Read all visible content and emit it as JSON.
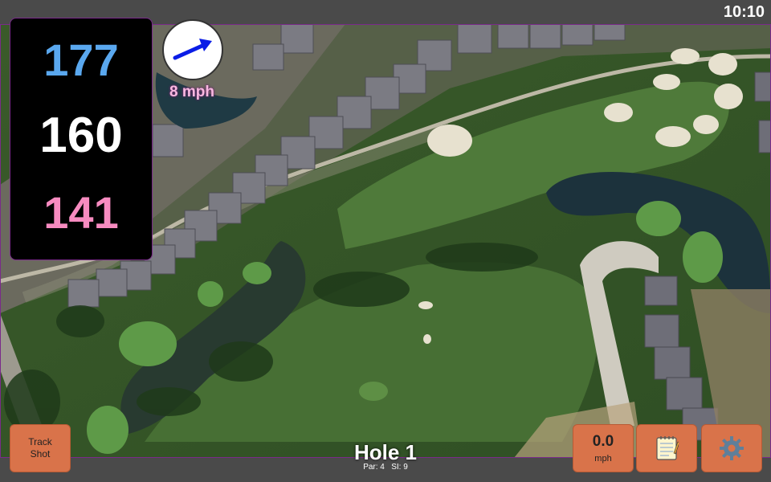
{
  "status": {
    "time": "10:10"
  },
  "yardage": {
    "back": "177",
    "center": "160",
    "front": "141"
  },
  "wind": {
    "speed_label": "8 mph",
    "icon": "wind-arrow-icon",
    "arrow_color": "#0a1de6"
  },
  "hole": {
    "title": "Hole 1",
    "par_label": "Par: 4",
    "si_label": "SI: 9"
  },
  "buttons": {
    "track_shot_line1": "Track",
    "track_shot_line2": "Shot",
    "speed_value": "0.0",
    "speed_unit": "mph",
    "notes_icon": "notepad-icon",
    "settings_icon": "gear-icon"
  },
  "colors": {
    "button_bg": "#d9734a",
    "back_yard": "#5aa8ef",
    "center_yard": "#ffffff",
    "front_yard": "#f78bc0",
    "panel_border": "#7a2a8a"
  }
}
